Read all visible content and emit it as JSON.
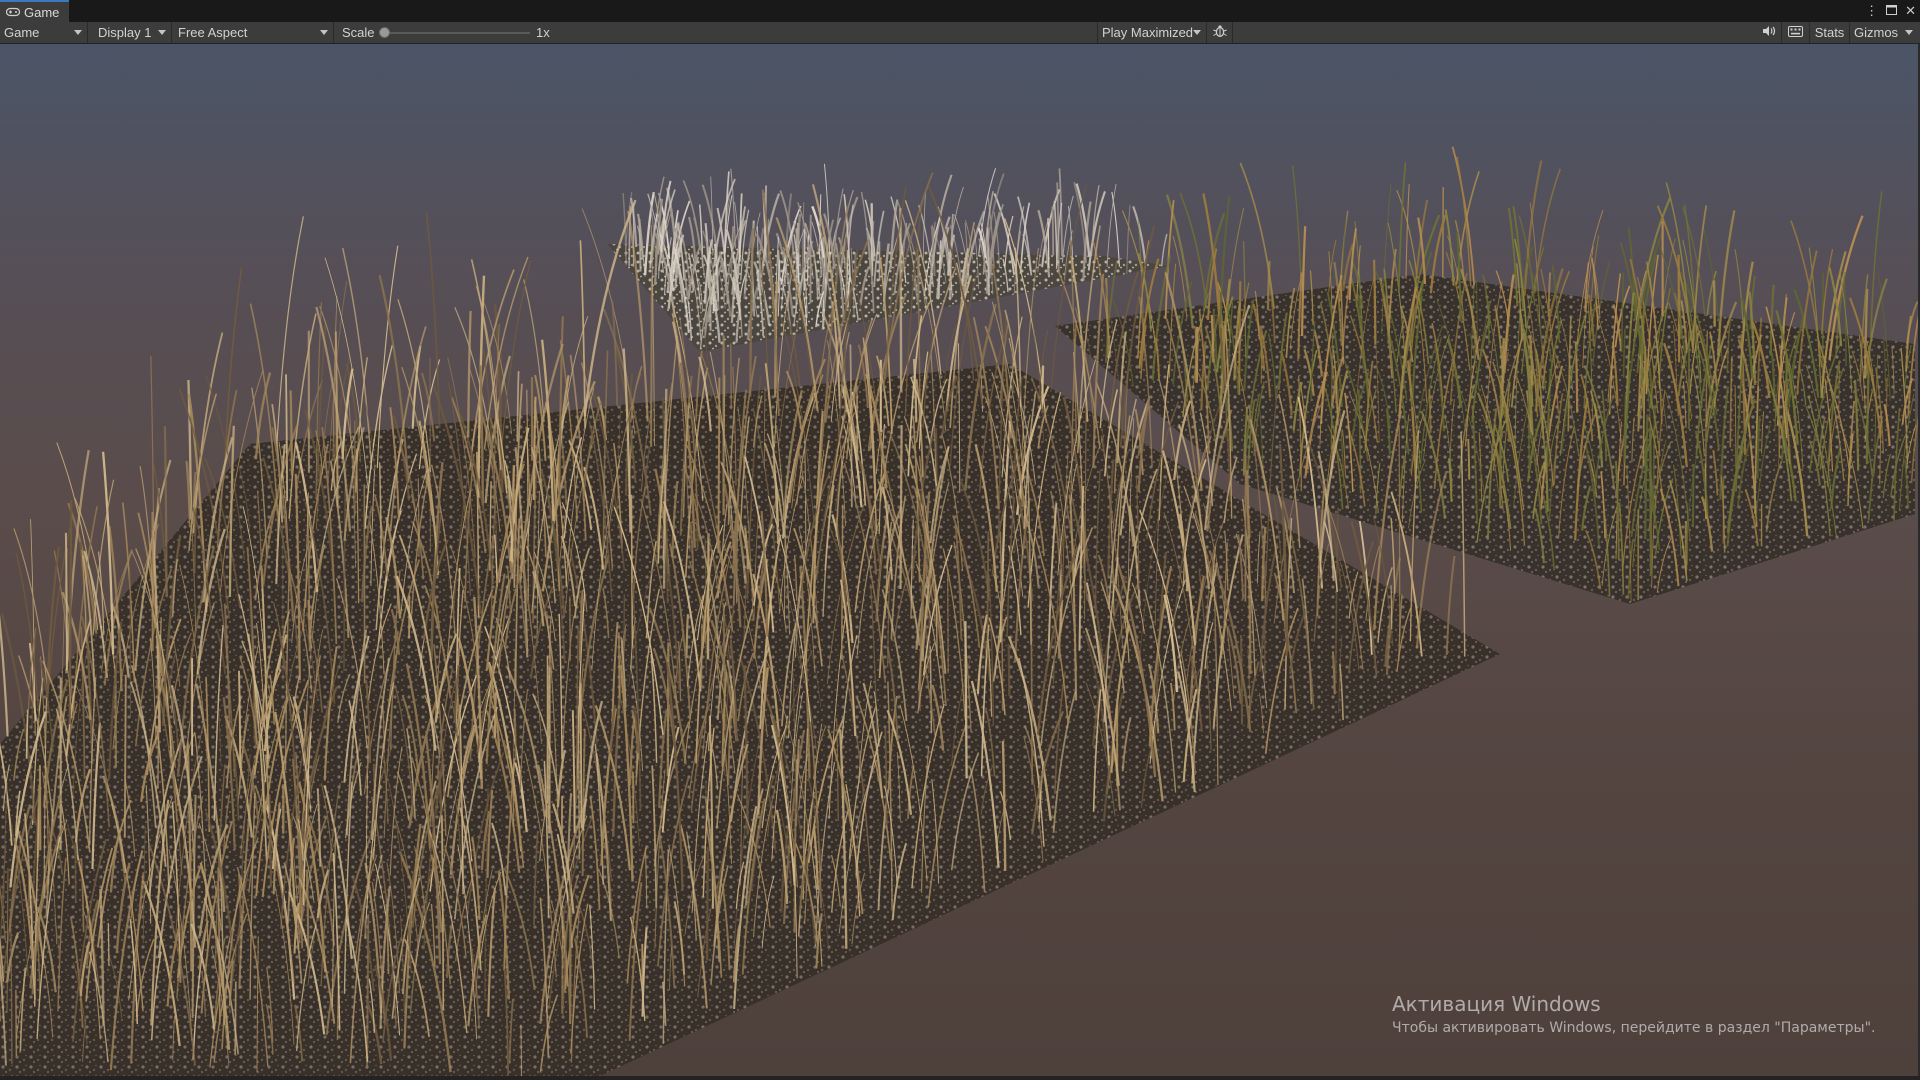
{
  "tab": {
    "title": "Game",
    "icon": "gamepad-icon"
  },
  "window_controls": {
    "more": "⋮",
    "maximize": "🗖",
    "close": "✕"
  },
  "toolbar": {
    "view_mode": "Game",
    "display": "Display 1",
    "aspect": "Free Aspect",
    "scale_label": "Scale",
    "scale_value": "1x",
    "scale_level": 0.0,
    "play_mode": "Play Maximized",
    "bug_icon": "bug-icon",
    "audio_icon": "speaker-icon",
    "keyboard_icon": "keyboard-icon",
    "stats_label": "Stats",
    "gizmos_label": "Gizmos"
  },
  "viewport": {
    "scene": "three grass terrain patches (dry grass) on a brown ground plane"
  },
  "watermark": {
    "title": "Активация Windows",
    "subtitle": "Чтобы активировать Windows, перейдите в раздел \"Параметры\"."
  },
  "colors": {
    "tab_accent": "#3a79bb",
    "toolbar_bg": "#3c3c3c",
    "grass_dry": "#a88a60",
    "grass_green": "#7a7a3a"
  }
}
